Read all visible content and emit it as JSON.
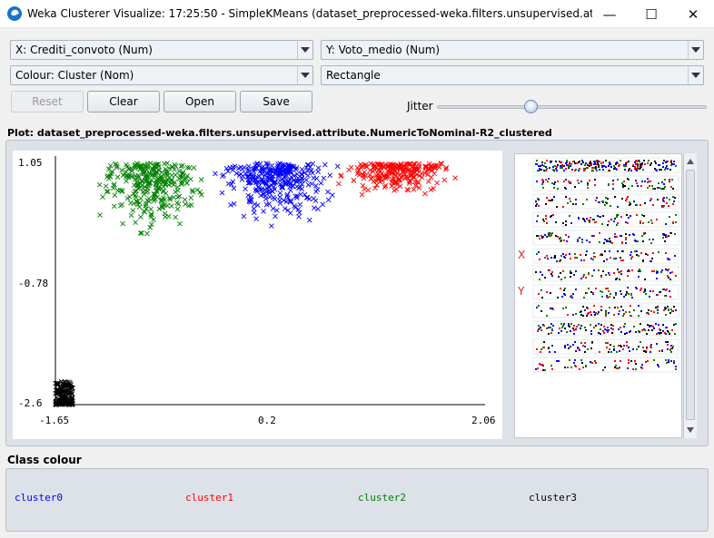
{
  "window": {
    "title": "Weka Clusterer Visualize: 17:25:50 - SimpleKMeans (dataset_preprocessed-weka.filters.unsupervised.attribute.Nume...",
    "minimize_glyph": "—",
    "maximize_glyph": "☐",
    "close_glyph": "✕"
  },
  "controls": {
    "x_axis": "X: Crediti_convoto (Num)",
    "y_axis": "Y: Voto_medio (Num)",
    "colour": "Colour: Cluster (Nom)",
    "shape": "Rectangle",
    "reset": "Reset",
    "clear": "Clear",
    "open": "Open",
    "save": "Save",
    "jitter_label": "Jitter",
    "jitter_value": 0.36
  },
  "plot": {
    "title": "Plot: dataset_preprocessed-weka.filters.unsupervised.attribute.NumericToNominal-R2_clustered",
    "y_ticks": [
      "1.05",
      "-0.78",
      "-2.6"
    ],
    "x_ticks": [
      "-1.65",
      "0.2",
      "2.06"
    ],
    "x_marker": "X",
    "y_marker": "Y"
  },
  "chart_data": {
    "type": "scatter",
    "xlabel": "Crediti_convoto",
    "ylabel": "Voto_medio",
    "xlim": [
      -1.65,
      2.06
    ],
    "ylim": [
      -2.6,
      1.05
    ],
    "marker": "x",
    "clusters": [
      {
        "name": "cluster0",
        "color": "#0000ff",
        "x_range": [
          -0.35,
          0.85
        ],
        "y_range": [
          0.05,
          1.05
        ]
      },
      {
        "name": "cluster1",
        "color": "#ff0000",
        "x_range": [
          0.7,
          1.9
        ],
        "y_range": [
          0.5,
          1.05
        ]
      },
      {
        "name": "cluster2",
        "color": "#008000",
        "x_range": [
          -1.35,
          -0.3
        ],
        "y_range": [
          -0.2,
          1.05
        ]
      },
      {
        "name": "cluster3",
        "color": "#000000",
        "x_range": [
          -1.65,
          -1.5
        ],
        "y_range": [
          -2.6,
          -2.25
        ]
      }
    ]
  },
  "legend": {
    "title": "Class colour",
    "items": [
      {
        "label": "cluster0",
        "color": "#0000ff"
      },
      {
        "label": "cluster1",
        "color": "#ff0000"
      },
      {
        "label": "cluster2",
        "color": "#008000"
      },
      {
        "label": "cluster3",
        "color": "#000000"
      }
    ]
  }
}
